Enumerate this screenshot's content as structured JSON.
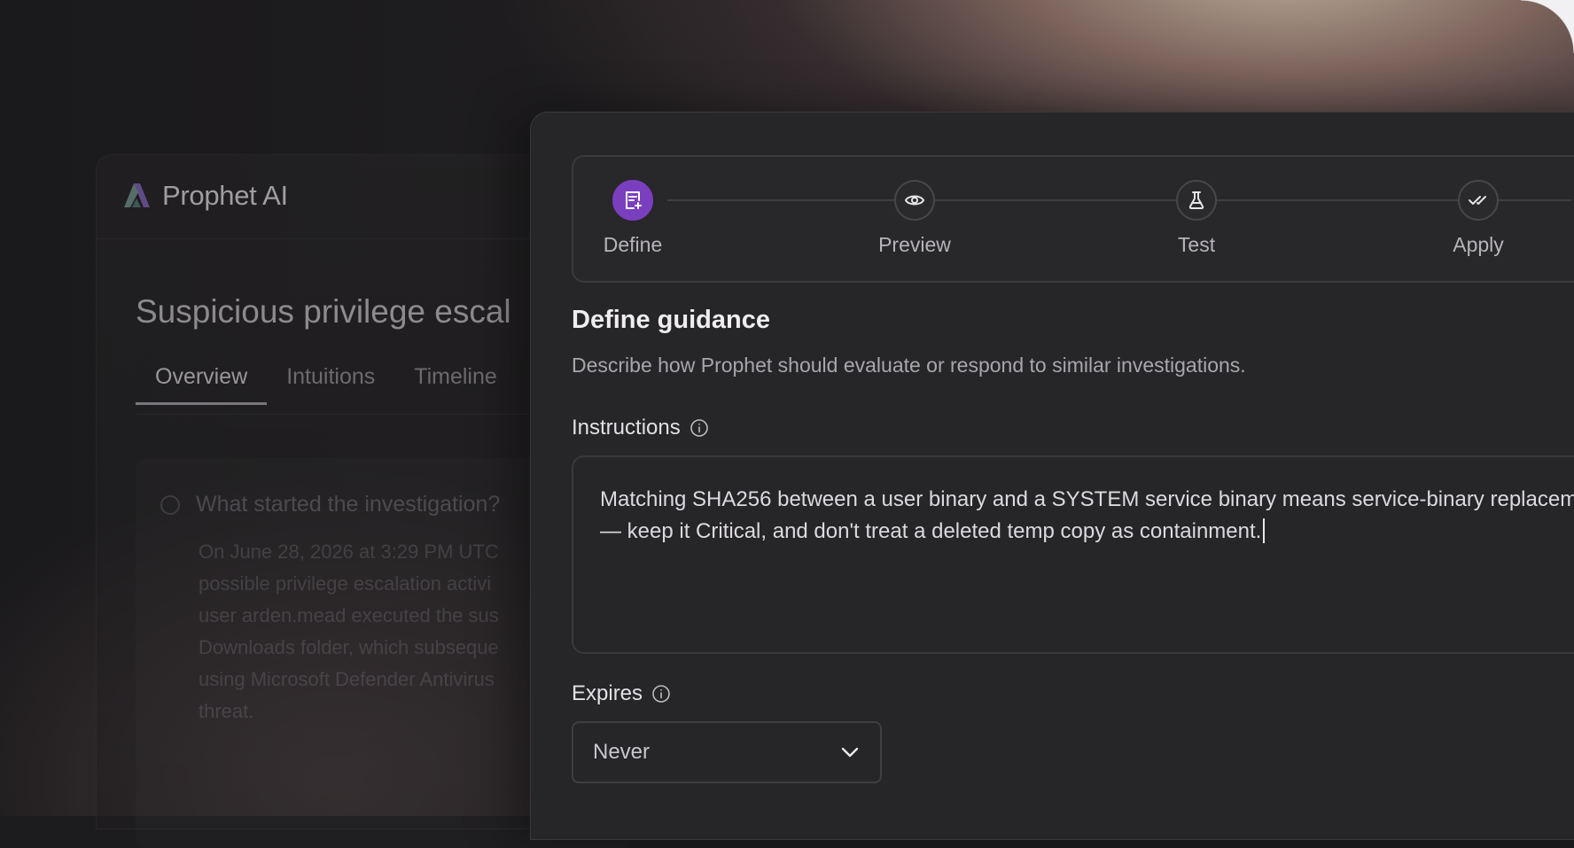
{
  "background_app": {
    "brand": "Prophet AI",
    "heading": "Suspicious privilege escal",
    "tabs": [
      {
        "label": "Overview",
        "active": true
      },
      {
        "label": "Intuitions",
        "active": false
      },
      {
        "label": "Timeline",
        "active": false
      }
    ],
    "question": "What started the investigation?",
    "paragraph_lines": [
      "On June 28, 2026 at 3:29 PM UTC",
      "possible privilege escalation activi",
      "user arden.mead executed the sus",
      "Downloads folder, which subseque",
      "using Microsoft Defender Antivirus",
      "threat."
    ]
  },
  "stepper": {
    "steps": [
      {
        "label": "Define",
        "icon": "note-add-icon",
        "active": true
      },
      {
        "label": "Preview",
        "icon": "eye-icon",
        "active": false
      },
      {
        "label": "Test",
        "icon": "flask-icon",
        "active": false
      },
      {
        "label": "Apply",
        "icon": "double-check-icon",
        "active": false
      }
    ]
  },
  "form": {
    "title": "Define guidance",
    "subtitle": "Describe how Prophet should evaluate or respond to similar investigations.",
    "instructions_label": "Instructions",
    "instructions_value": "Matching SHA256 between a user binary and a SYSTEM service binary means service-binary replacement — keep it Critical, and don't treat a deleted temp copy as containment.",
    "expires_label": "Expires",
    "expires_value": "Never"
  },
  "colors": {
    "accent": "#7a3fbf",
    "panel": "#262528",
    "border": "#3a393d"
  }
}
